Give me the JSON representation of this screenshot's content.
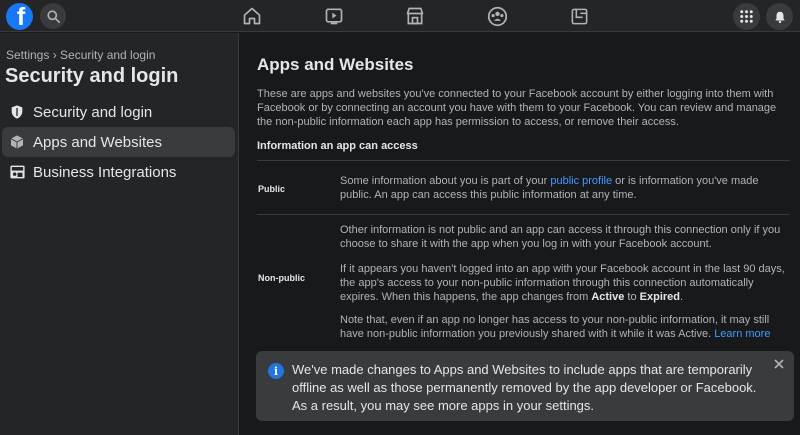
{
  "topbar": {
    "logo_letter": "f",
    "icons": [
      "facebook-logo",
      "search-icon",
      "home-icon",
      "watch-icon",
      "marketplace-icon",
      "groups-icon",
      "gaming-icon",
      "menu-grid-icon",
      "notifications-icon"
    ]
  },
  "sidebar": {
    "breadcrumb": "Settings › Security and login",
    "title": "Security and login",
    "items": [
      {
        "label": "Security and login",
        "icon": "shield-icon"
      },
      {
        "label": "Apps and Websites",
        "icon": "cube-icon"
      },
      {
        "label": "Business Integrations",
        "icon": "business-icon"
      }
    ],
    "active_index": 1
  },
  "main": {
    "title": "Apps and Websites",
    "intro": "These are apps and websites you've connected to your Facebook account by either logging into them with Facebook or by connecting an account you have with them to your Facebook. You can review and manage the non-public information each app has permission to access, or remove their access.",
    "section_heading": "Information an app can access",
    "public": {
      "label": "Public",
      "text_before": "Some information about you is part of your ",
      "link": "public profile",
      "text_after": " or is information you've made public. An app can access this public information at any time."
    },
    "non_public": {
      "label": "Non-public",
      "para1": "Other information is not public and an app can access it through this connection only if you choose to share it with the app when you log in with your Facebook account.",
      "para2_before": "If it appears you haven't logged into an app with your Facebook account in the last 90 days, the app's access to your non-public information through this connection automatically expires. When this happens, the app changes from ",
      "active_word": "Active",
      "para2_mid": " to ",
      "expired_word": "Expired",
      "para2_after": ".",
      "para3": "Note that, even if an app no longer has access to your non-public information, it may still have non-public information you previously shared with it while it was Active. ",
      "learn_more": "Learn more"
    }
  },
  "notice": {
    "info_glyph": "i",
    "text": "We've made changes to Apps and Websites to include apps that are temporarily offline as well as those permanently removed by the app developer or Facebook. As a result, you may see more apps in your settings."
  },
  "colors": {
    "background": "#18191a",
    "surface": "#242526",
    "hover": "#3a3b3c",
    "brand": "#1877f2",
    "link": "#4599ff"
  }
}
